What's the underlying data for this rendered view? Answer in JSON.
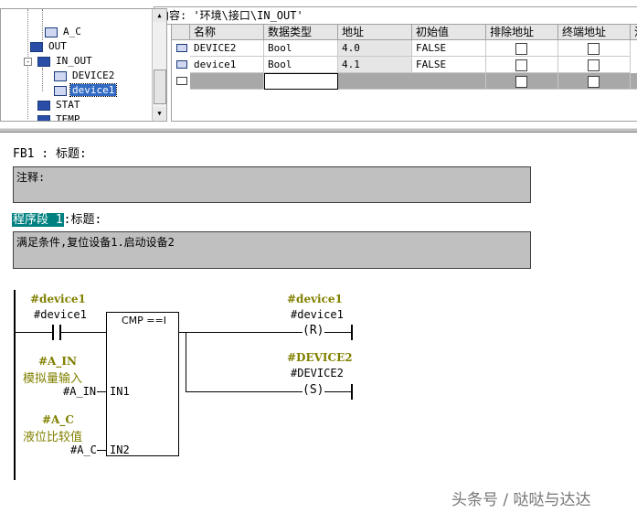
{
  "tree": {
    "items": [
      {
        "label": "A_C",
        "type": "param"
      },
      {
        "label": "OUT",
        "type": "section"
      },
      {
        "label": "IN_OUT",
        "type": "section",
        "expanded": "-"
      },
      {
        "label": "DEVICE2",
        "type": "param"
      },
      {
        "label": "device1",
        "type": "param",
        "selected": true
      },
      {
        "label": "STAT",
        "type": "section"
      },
      {
        "label": "TEMP",
        "type": "section"
      }
    ],
    "scroll_up_icon": "▲",
    "scroll_down_icon": "▼"
  },
  "path_bar": {
    "text": "内容:  '环境\\接口\\IN_OUT'"
  },
  "grid": {
    "columns": [
      "名称",
      "数据类型",
      "地址",
      "初始值",
      "排除地址",
      "终端地址",
      "注"
    ],
    "rows": [
      {
        "name": "DEVICE2",
        "type": "Bool",
        "address": "4.0",
        "initial": "FALSE"
      },
      {
        "name": "device1",
        "type": "Bool",
        "address": "4.1",
        "initial": "FALSE"
      }
    ]
  },
  "block": {
    "header": "FB1 : 标题:",
    "comment_label": "注释:",
    "network_title_highlight": "程序段 1",
    "network_title_suffix": ":标题:",
    "network_comment": "满足条件,复位设备1.启动设备2"
  },
  "ladder": {
    "contact": {
      "symbol": "#device1",
      "operand": "#device1"
    },
    "compare": {
      "label": "CMP ==I",
      "in1_pin": "IN1",
      "in2_pin": "IN2"
    },
    "in1": {
      "symbol": "#A_IN",
      "comment": "模拟量输入",
      "operand": "#A_IN"
    },
    "in2": {
      "symbol": "#A_C",
      "comment": "液位比较值",
      "operand": "#A_C"
    },
    "coil_reset": {
      "symbol": "#device1",
      "operand": "#device1",
      "glyph": "R"
    },
    "coil_set": {
      "symbol": "#DEVICE2",
      "operand": "#DEVICE2",
      "glyph": "S"
    }
  },
  "watermark": "头条号 / 哒哒与达达"
}
